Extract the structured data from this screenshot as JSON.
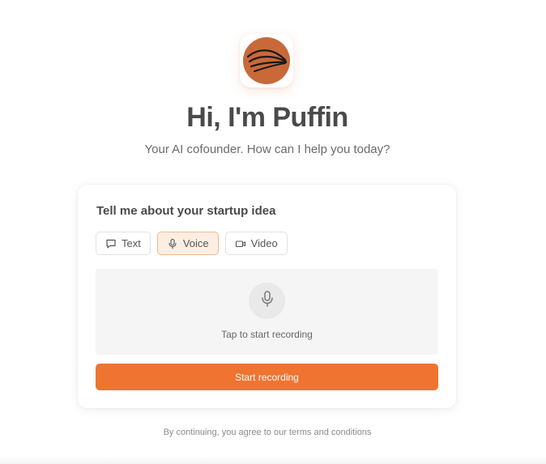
{
  "brand": {
    "logo_icon": "puffin-logo",
    "logo_color": "#c9693a"
  },
  "hero": {
    "title": "Hi, I'm Puffin",
    "subtitle": "Your AI cofounder. How can I help you today?"
  },
  "card": {
    "heading": "Tell me about your startup idea",
    "modes": [
      {
        "label": "Text",
        "icon": "message-icon",
        "active": false
      },
      {
        "label": "Voice",
        "icon": "microphone-icon",
        "active": true
      },
      {
        "label": "Video",
        "icon": "video-camera-icon",
        "active": false
      }
    ],
    "recording": {
      "icon": "microphone-icon",
      "hint": "Tap to start recording"
    },
    "start_button_label": "Start recording"
  },
  "footer": {
    "text": "By continuing, you agree to our terms and conditions"
  },
  "colors": {
    "accent": "#ef7431",
    "active_tab_bg": "#fdeee2",
    "active_tab_border": "#f1b88e"
  }
}
